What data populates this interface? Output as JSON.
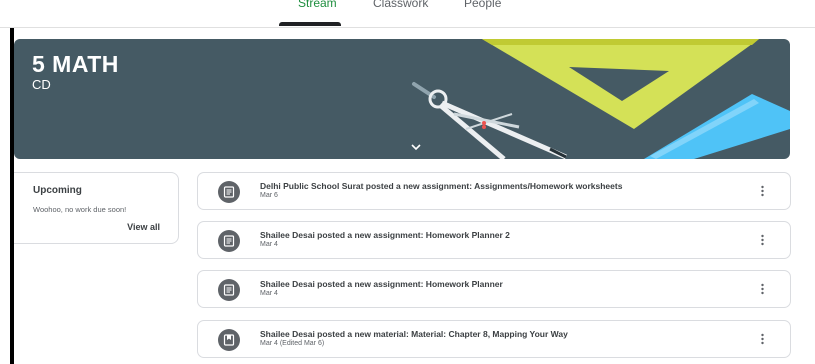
{
  "tabs": [
    {
      "label": "Stream",
      "active": true
    },
    {
      "label": "Classwork",
      "active": false
    },
    {
      "label": "People",
      "active": false
    }
  ],
  "banner": {
    "title": "5 MATH",
    "subtitle": "CD",
    "color": "#455a64"
  },
  "upcoming": {
    "title": "Upcoming",
    "message": "Woohoo, no work due soon!",
    "link": "View all"
  },
  "stream": [
    {
      "type": "assignment",
      "icon": "assignment-icon",
      "title": "Delhi Public School Surat posted a new assignment: Assignments/Homework worksheets",
      "date": "Mar 6"
    },
    {
      "type": "assignment",
      "icon": "assignment-icon",
      "title": "Shailee Desai posted a new assignment: Homework Planner 2",
      "date": "Mar 4"
    },
    {
      "type": "assignment",
      "icon": "assignment-icon",
      "title": "Shailee Desai posted a new assignment: Homework Planner",
      "date": "Mar 4"
    },
    {
      "type": "material",
      "icon": "material-icon",
      "title": "Shailee Desai posted a new material: Material: Chapter 8, Mapping Your Way",
      "date": "Mar 4 (Edited Mar 6)"
    }
  ]
}
